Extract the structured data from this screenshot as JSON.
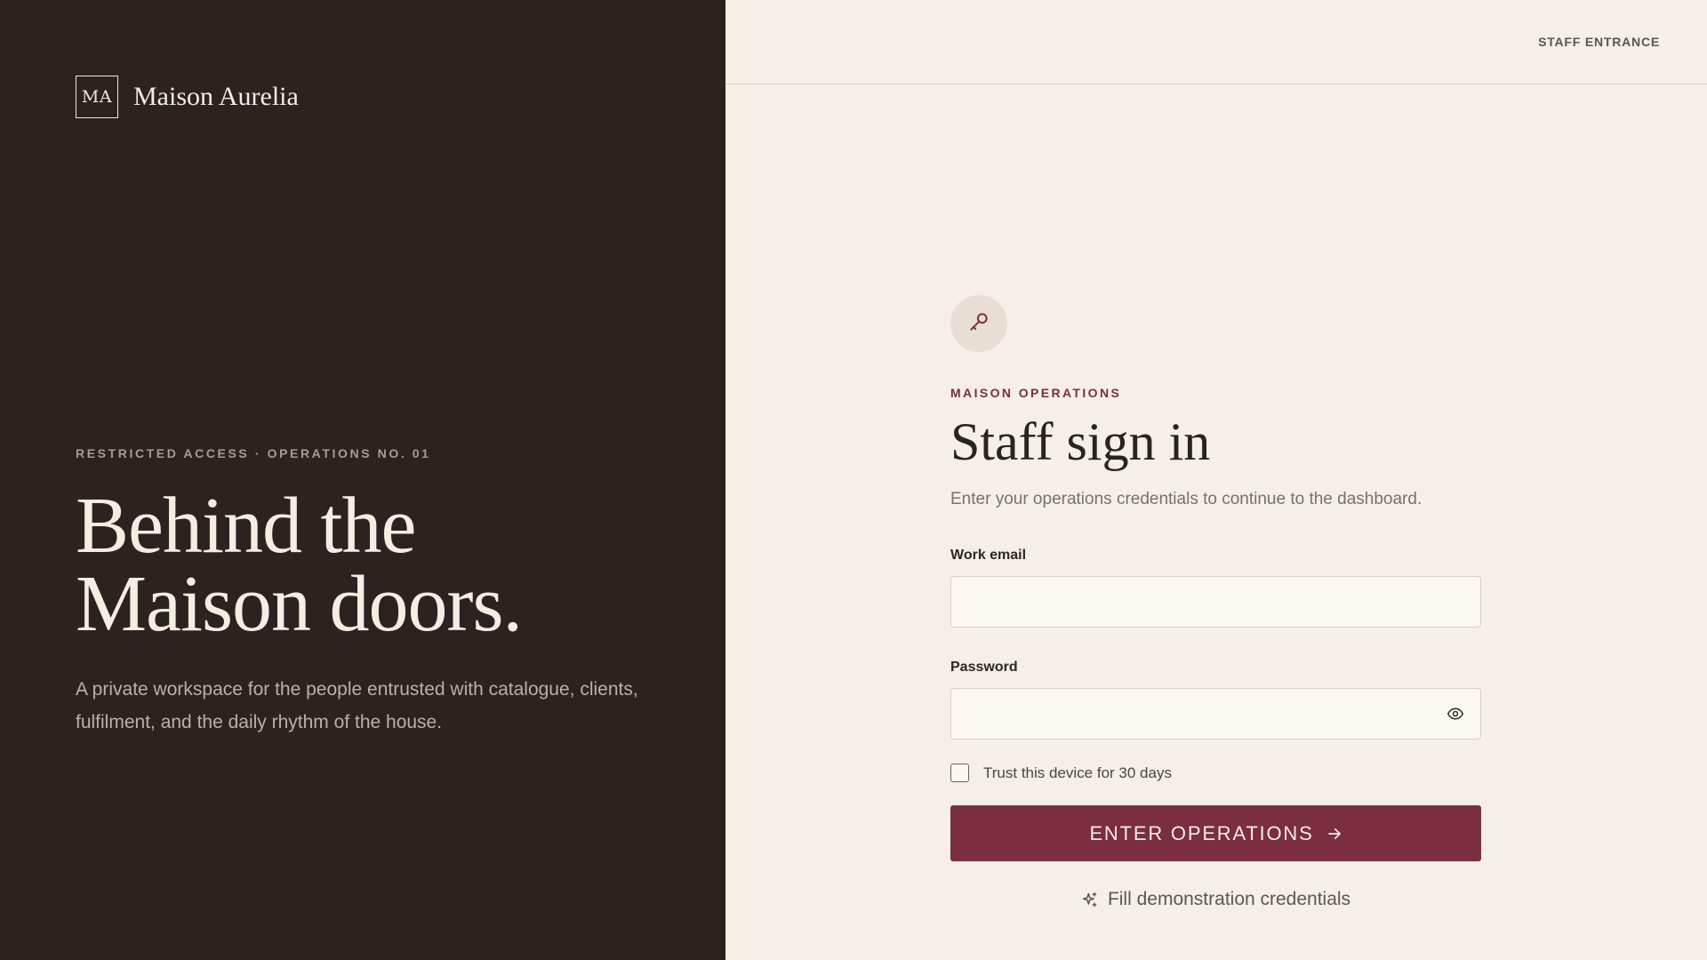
{
  "brand": {
    "mark": "MA",
    "name": "Maison Aurelia"
  },
  "hero": {
    "eyebrow": "RESTRICTED ACCESS · OPERATIONS NO. 01",
    "title_line1": "Behind the",
    "title_line2": "Maison doors.",
    "copy": "A private workspace for the people entrusted with catalogue, clients, fulfilment, and the daily rhythm of the house."
  },
  "topbar": {
    "link": "STAFF ENTRANCE"
  },
  "form": {
    "badge_icon": "key-icon",
    "eyebrow": "MAISON OPERATIONS",
    "title": "Staff sign in",
    "subtitle": "Enter your operations credentials to continue to the dashboard.",
    "email_label": "Work email",
    "email_value": "",
    "password_label": "Password",
    "password_value": "",
    "reveal_icon": "eye-icon",
    "trust_label": "Trust this device for 30 days",
    "trust_checked": false,
    "submit_label": "ENTER OPERATIONS",
    "submit_icon": "arrow-right-icon",
    "demo_label": "Fill demonstration credentials",
    "demo_icon": "sparkle-icon"
  },
  "colors": {
    "panel_dark": "#2c2220",
    "panel_light": "#f5efe5",
    "accent": "#7a2e3f",
    "badge_bg": "#e8ded3"
  }
}
